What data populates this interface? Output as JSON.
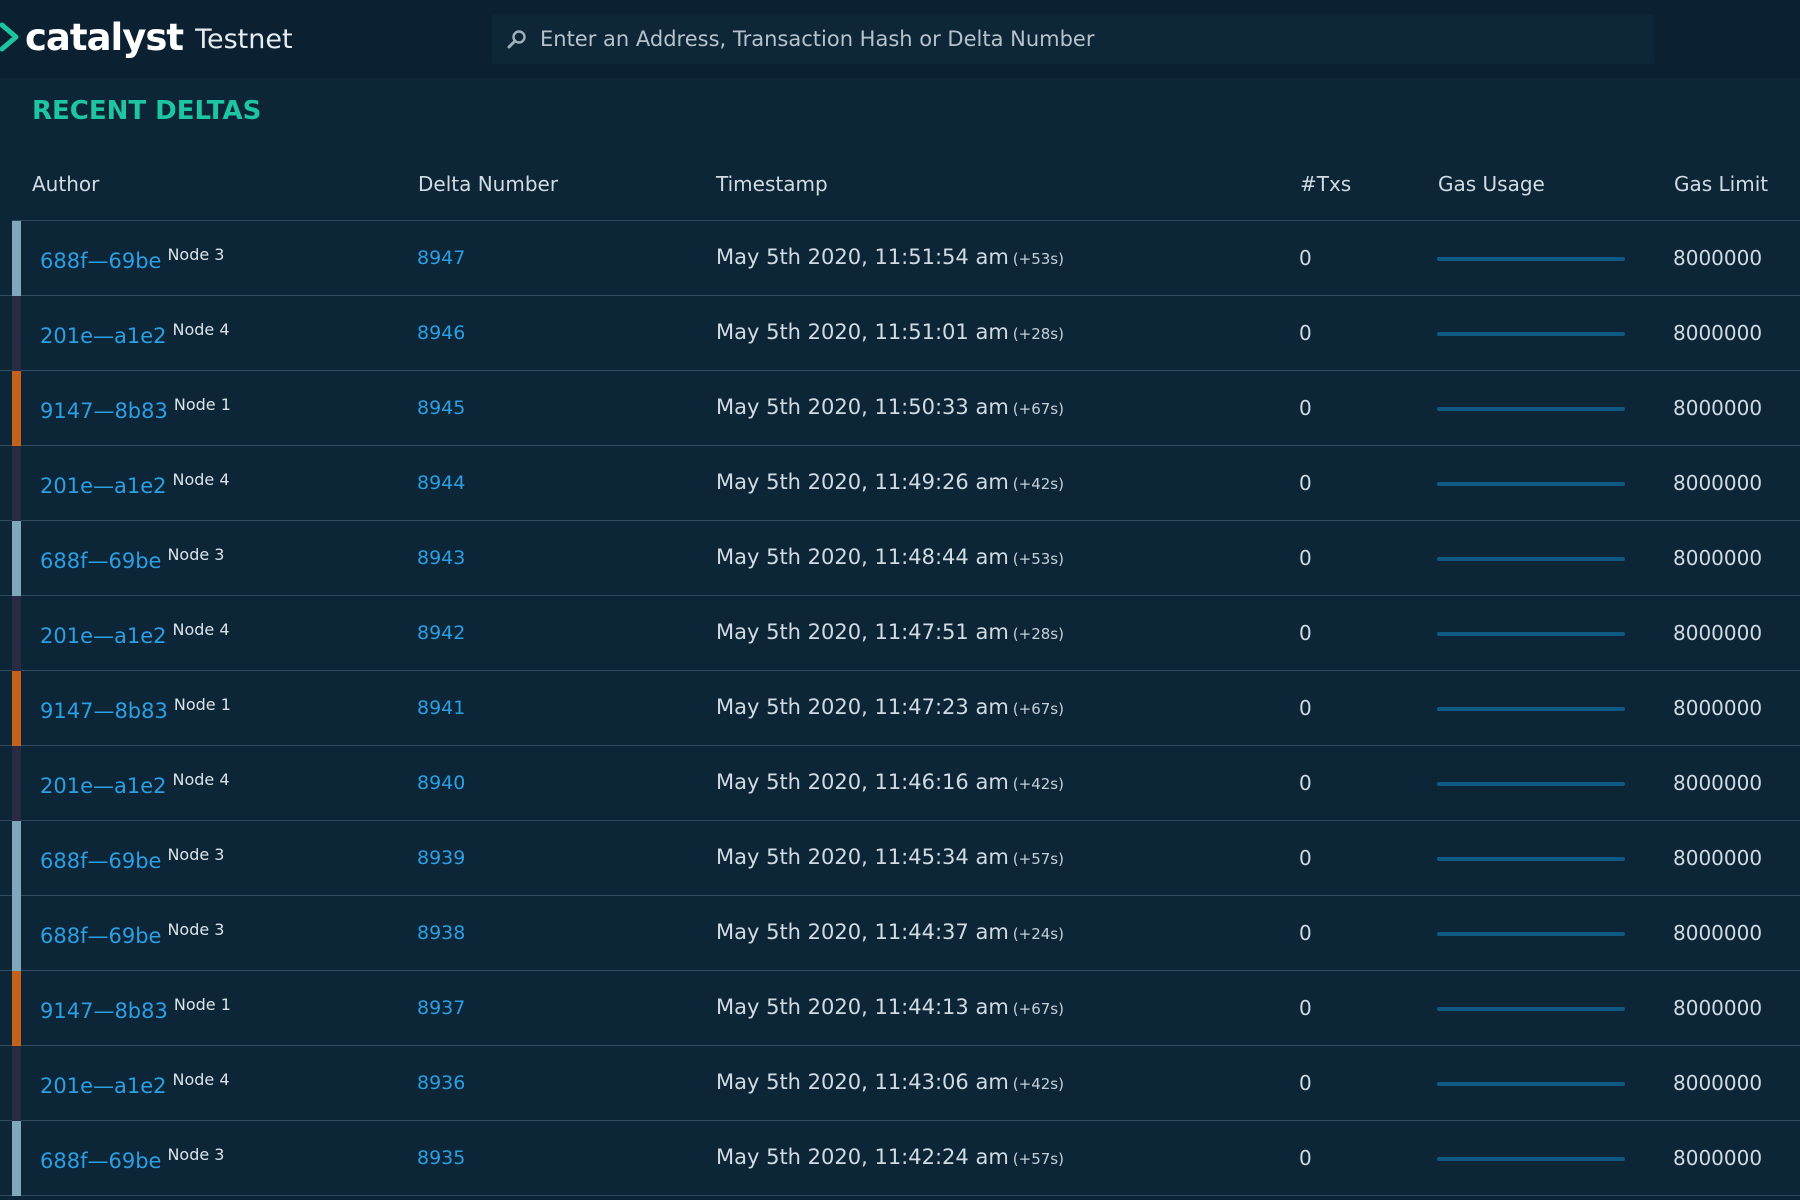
{
  "header": {
    "brand": "catalyst",
    "network": "Testnet",
    "search_placeholder": "Enter an Address, Transaction Hash or Delta Number"
  },
  "section_title": "RECENT DELTAS",
  "columns": {
    "author": "Author",
    "delta_number": "Delta Number",
    "timestamp": "Timestamp",
    "txs": "#Txs",
    "gas_usage": "Gas Usage",
    "gas_limit": "Gas Limit"
  },
  "node_colors": {
    "Node 1": "#c4621c",
    "Node 3": "#7fa9ba",
    "Node 4": "#2a2a45"
  },
  "rows": [
    {
      "author": "688f—69be",
      "node": "Node 3",
      "delta": "8947",
      "timestamp": "May 5th 2020, 11:51:54 am",
      "delta_time": "(+53s)",
      "txs": "0",
      "gas_usage": 0,
      "gas_limit": "8000000"
    },
    {
      "author": "201e—a1e2",
      "node": "Node 4",
      "delta": "8946",
      "timestamp": "May 5th 2020, 11:51:01 am",
      "delta_time": "(+28s)",
      "txs": "0",
      "gas_usage": 0,
      "gas_limit": "8000000"
    },
    {
      "author": "9147—8b83",
      "node": "Node 1",
      "delta": "8945",
      "timestamp": "May 5th 2020, 11:50:33 am",
      "delta_time": "(+67s)",
      "txs": "0",
      "gas_usage": 0,
      "gas_limit": "8000000"
    },
    {
      "author": "201e—a1e2",
      "node": "Node 4",
      "delta": "8944",
      "timestamp": "May 5th 2020, 11:49:26 am",
      "delta_time": "(+42s)",
      "txs": "0",
      "gas_usage": 0,
      "gas_limit": "8000000"
    },
    {
      "author": "688f—69be",
      "node": "Node 3",
      "delta": "8943",
      "timestamp": "May 5th 2020, 11:48:44 am",
      "delta_time": "(+53s)",
      "txs": "0",
      "gas_usage": 0,
      "gas_limit": "8000000"
    },
    {
      "author": "201e—a1e2",
      "node": "Node 4",
      "delta": "8942",
      "timestamp": "May 5th 2020, 11:47:51 am",
      "delta_time": "(+28s)",
      "txs": "0",
      "gas_usage": 0,
      "gas_limit": "8000000"
    },
    {
      "author": "9147—8b83",
      "node": "Node 1",
      "delta": "8941",
      "timestamp": "May 5th 2020, 11:47:23 am",
      "delta_time": "(+67s)",
      "txs": "0",
      "gas_usage": 0,
      "gas_limit": "8000000"
    },
    {
      "author": "201e—a1e2",
      "node": "Node 4",
      "delta": "8940",
      "timestamp": "May 5th 2020, 11:46:16 am",
      "delta_time": "(+42s)",
      "txs": "0",
      "gas_usage": 0,
      "gas_limit": "8000000"
    },
    {
      "author": "688f—69be",
      "node": "Node 3",
      "delta": "8939",
      "timestamp": "May 5th 2020, 11:45:34 am",
      "delta_time": "(+57s)",
      "txs": "0",
      "gas_usage": 0,
      "gas_limit": "8000000"
    },
    {
      "author": "688f—69be",
      "node": "Node 3",
      "delta": "8938",
      "timestamp": "May 5th 2020, 11:44:37 am",
      "delta_time": "(+24s)",
      "txs": "0",
      "gas_usage": 0,
      "gas_limit": "8000000"
    },
    {
      "author": "9147—8b83",
      "node": "Node 1",
      "delta": "8937",
      "timestamp": "May 5th 2020, 11:44:13 am",
      "delta_time": "(+67s)",
      "txs": "0",
      "gas_usage": 0,
      "gas_limit": "8000000"
    },
    {
      "author": "201e—a1e2",
      "node": "Node 4",
      "delta": "8936",
      "timestamp": "May 5th 2020, 11:43:06 am",
      "delta_time": "(+42s)",
      "txs": "0",
      "gas_usage": 0,
      "gas_limit": "8000000"
    },
    {
      "author": "688f—69be",
      "node": "Node 3",
      "delta": "8935",
      "timestamp": "May 5th 2020, 11:42:24 am",
      "delta_time": "(+57s)",
      "txs": "0",
      "gas_usage": 0,
      "gas_limit": "8000000"
    }
  ]
}
